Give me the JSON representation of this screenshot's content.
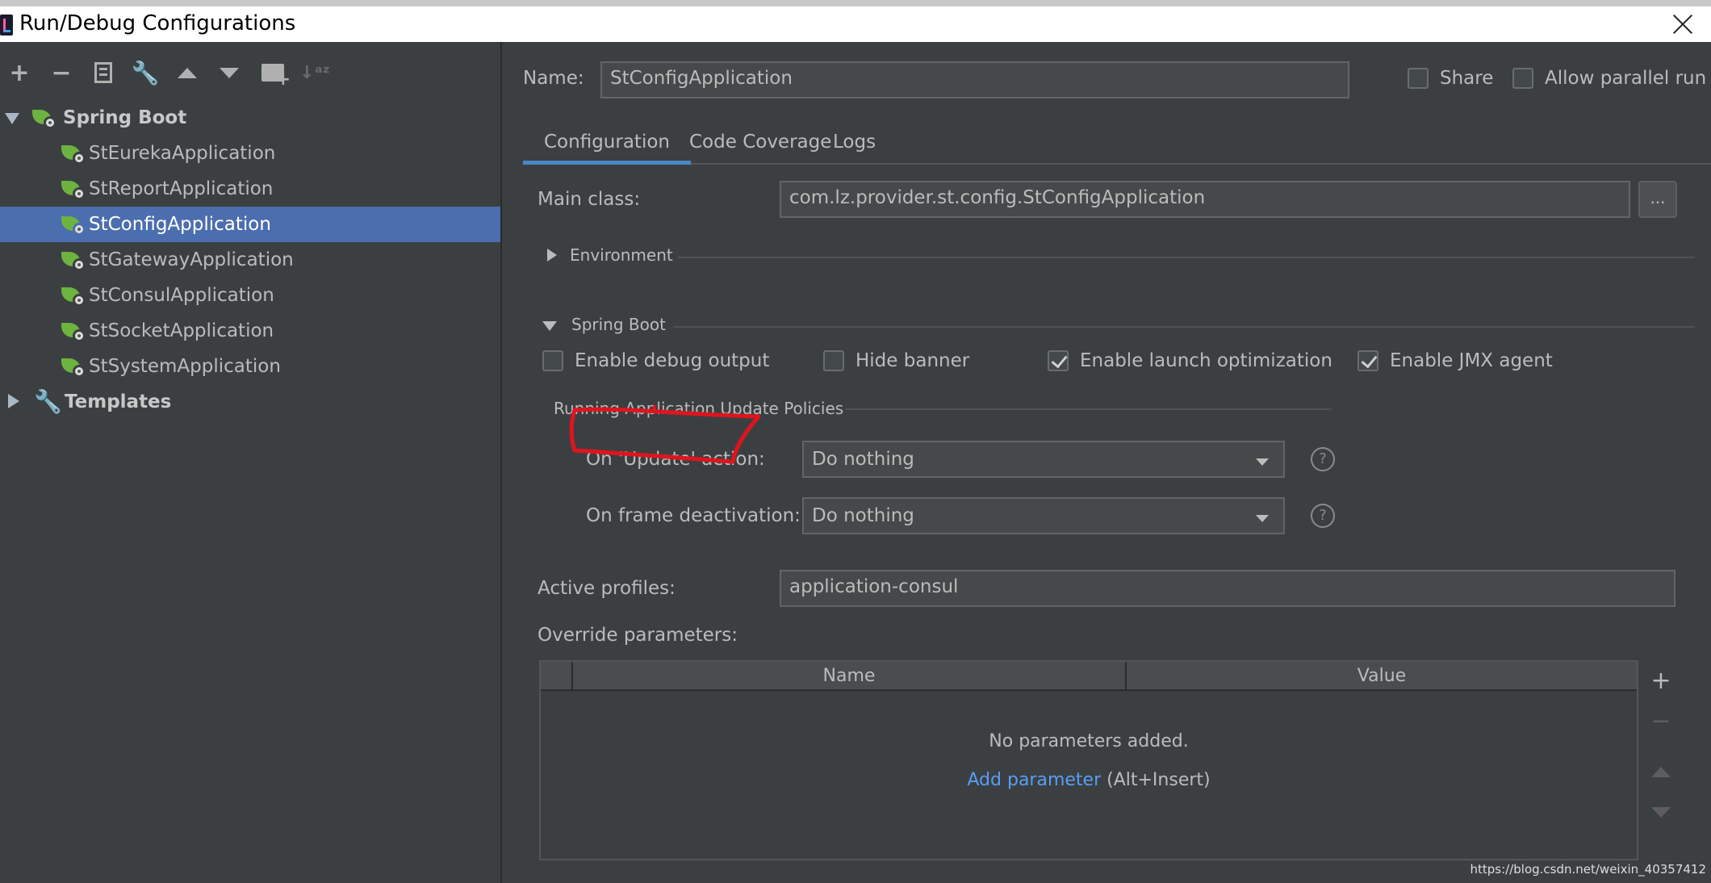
{
  "window": {
    "title": "Run/Debug Configurations"
  },
  "toolbar": {
    "add": "+",
    "remove": "−",
    "sort": "↓ᵃᶻ"
  },
  "tree": {
    "group_label": "Spring Boot",
    "items": [
      {
        "label": "StEurekaApplication"
      },
      {
        "label": "StReportApplication"
      },
      {
        "label": "StConfigApplication"
      },
      {
        "label": "StGatewayApplication"
      },
      {
        "label": "StConsulApplication"
      },
      {
        "label": "StSocketApplication"
      },
      {
        "label": "StSystemApplication"
      }
    ],
    "templates_label": "Templates"
  },
  "header": {
    "name_label": "Name:",
    "name_value": "StConfigApplication",
    "share_label": "Share",
    "allow_parallel_label": "Allow parallel run"
  },
  "tabs": [
    {
      "label": "Configuration"
    },
    {
      "label": "Code Coverage"
    },
    {
      "label": "Logs"
    }
  ],
  "config": {
    "main_class_label": "Main class:",
    "main_class_value": "com.lz.provider.st.config.StConfigApplication",
    "browse_label": "...",
    "environment_label": "Environment",
    "spring_boot_label": "Spring Boot",
    "options": [
      {
        "label": "Enable debug output",
        "checked": false
      },
      {
        "label": "Hide banner",
        "checked": false
      },
      {
        "label": "Enable launch optimization",
        "checked": true
      },
      {
        "label": "Enable JMX agent",
        "checked": true
      }
    ],
    "update_policies_label": "Running Application Update Policies",
    "on_update_label": "On 'Update' action:",
    "on_update_value": "Do nothing",
    "on_frame_label": "On frame deactivation:",
    "on_frame_value": "Do nothing",
    "help_glyph": "?",
    "active_profiles_label": "Active profiles:",
    "active_profiles_value": "application-consul",
    "override_label": "Override parameters:",
    "table_headers": [
      "Name",
      "Value"
    ],
    "empty_message": "No parameters added.",
    "add_param_link": "Add parameter",
    "add_param_shortcut": " (Alt+Insert)"
  },
  "watermark": "https://blog.csdn.net/weixin_40357412",
  "colors": {
    "selection": "#4b6eaf",
    "annotation": "#e0141e",
    "link": "#589df6"
  }
}
